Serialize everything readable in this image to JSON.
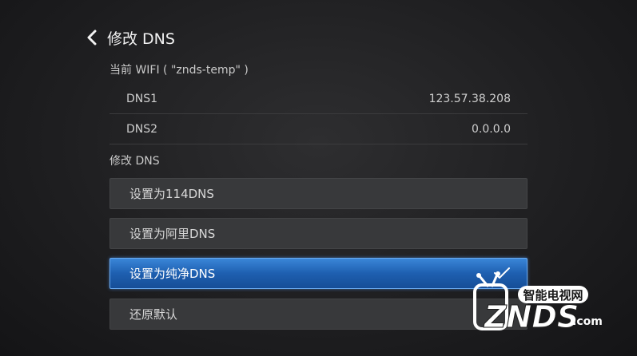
{
  "header": {
    "title": "修改 DNS"
  },
  "current_wifi": {
    "label": "当前 WIFI ( \"znds-temp\" )"
  },
  "dns_info": [
    {
      "name": "DNS1",
      "value": "123.57.38.208"
    },
    {
      "name": "DNS2",
      "value": "0.0.0.0"
    }
  ],
  "modify_section": {
    "label": "修改 DNS"
  },
  "options": [
    {
      "label": "设置为114DNS",
      "selected": false
    },
    {
      "label": "设置为阿里DNS",
      "selected": false
    },
    {
      "label": "设置为纯净DNS",
      "selected": true
    },
    {
      "label": "还原默认",
      "selected": false
    }
  ],
  "watermark": {
    "tagline": "智能电视网",
    "brand": "ZNDS",
    "suffix": ".com"
  },
  "colors": {
    "selected_option": "#1e5fb0",
    "option_bg": "#38393b",
    "background": "#1f1f21"
  },
  "icons": {
    "back": "chevron-left-icon",
    "selected_mark": "check-icon"
  }
}
